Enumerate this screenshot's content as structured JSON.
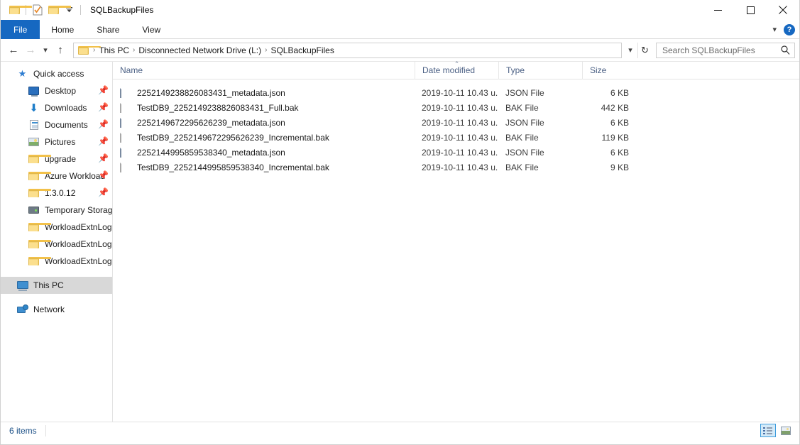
{
  "window": {
    "title": "SQLBackupFiles",
    "quick_access": [
      {
        "name": "folder-icon",
        "label": "Folder"
      },
      {
        "name": "properties-icon",
        "label": "Properties"
      },
      {
        "name": "new-folder-icon",
        "label": "New folder"
      },
      {
        "name": "customize-dropdown-icon",
        "label": "Customize Quick Access Toolbar"
      }
    ],
    "caption": {
      "minimize": "Minimize",
      "maximize": "Maximize",
      "close": "Close"
    }
  },
  "ribbon": {
    "tabs": [
      {
        "label": "File"
      },
      {
        "label": "Home"
      },
      {
        "label": "Share"
      },
      {
        "label": "View"
      }
    ],
    "expand_label": "Expand the Ribbon",
    "help_label": "?"
  },
  "address": {
    "back": "Back",
    "forward": "Forward",
    "recent": "Recent locations",
    "up": "Up",
    "breadcrumbs": [
      "This PC",
      "Disconnected Network Drive (L:)",
      "SQLBackupFiles"
    ],
    "separator": "›",
    "dropdown": "Previous locations",
    "refresh": "Refresh"
  },
  "search": {
    "placeholder": "Search SQLBackupFiles",
    "value": ""
  },
  "navpane": {
    "groups": [
      {
        "name": "quick-access",
        "label": "Quick access",
        "icon": "star-icon",
        "items": [
          {
            "label": "Desktop",
            "icon": "desktop-icon",
            "pinned": true
          },
          {
            "label": "Downloads",
            "icon": "download-icon",
            "pinned": true
          },
          {
            "label": "Documents",
            "icon": "documents-icon",
            "pinned": true
          },
          {
            "label": "Pictures",
            "icon": "pictures-icon",
            "pinned": true
          },
          {
            "label": "upgrade",
            "icon": "folder-icon",
            "pinned": true
          },
          {
            "label": "Azure Workload",
            "icon": "folder-icon",
            "pinned": true
          },
          {
            "label": "1.3.0.12",
            "icon": "folder-icon",
            "pinned": true
          },
          {
            "label": "Temporary Storage",
            "icon": "drive-icon",
            "pinned": false
          },
          {
            "label": "WorkloadExtnLogFolder",
            "icon": "folder-icon",
            "pinned": false
          },
          {
            "label": "WorkloadExtnLogFolder",
            "icon": "folder-icon",
            "pinned": false
          },
          {
            "label": "WorkloadExtnLogFolder",
            "icon": "folder-icon",
            "pinned": false
          }
        ]
      }
    ],
    "roots": [
      {
        "label": "This PC",
        "icon": "this-pc-icon",
        "selected": true
      },
      {
        "label": "Network",
        "icon": "network-icon",
        "selected": false
      }
    ]
  },
  "filelist": {
    "columns": [
      {
        "key": "name",
        "label": "Name",
        "sorted": false
      },
      {
        "key": "date",
        "label": "Date modified",
        "sorted": true,
        "direction": "ascending"
      },
      {
        "key": "type",
        "label": "Type",
        "sorted": false
      },
      {
        "key": "size",
        "label": "Size",
        "sorted": false
      }
    ],
    "sort_caret": "⌃",
    "rows": [
      {
        "name": "2252149238826083431_metadata.json",
        "date": "2019-10-11 10.43 u.",
        "type": "JSON File",
        "size": "6 KB",
        "icon": "json-file-icon"
      },
      {
        "name": "TestDB9_2252149238826083431_Full.bak",
        "date": "2019-10-11 10.43 u.",
        "type": "BAK File",
        "size": "442 KB",
        "icon": "bak-file-icon"
      },
      {
        "name": "2252149672295626239_metadata.json",
        "date": "2019-10-11 10.43 u.",
        "type": "JSON File",
        "size": "6 KB",
        "icon": "json-file-icon"
      },
      {
        "name": "TestDB9_2252149672295626239_Incremental.bak",
        "date": "2019-10-11 10.43 u.",
        "type": "BAK File",
        "size": "119 KB",
        "icon": "bak-file-icon"
      },
      {
        "name": "2252144995859538340_metadata.json",
        "date": "2019-10-11 10.43 u.",
        "type": "JSON File",
        "size": "6 KB",
        "icon": "json-file-icon"
      },
      {
        "name": "TestDB9_2252144995859538340_Incremental.bak",
        "date": "2019-10-11 10.43 u.",
        "type": "BAK File",
        "size": "9 KB",
        "icon": "bak-file-icon"
      }
    ]
  },
  "statusbar": {
    "item_count": "6 items",
    "views": [
      {
        "name": "details-view",
        "label": "Details view",
        "active": true
      },
      {
        "name": "large-icons-view",
        "label": "Large icons view",
        "active": false
      }
    ]
  }
}
